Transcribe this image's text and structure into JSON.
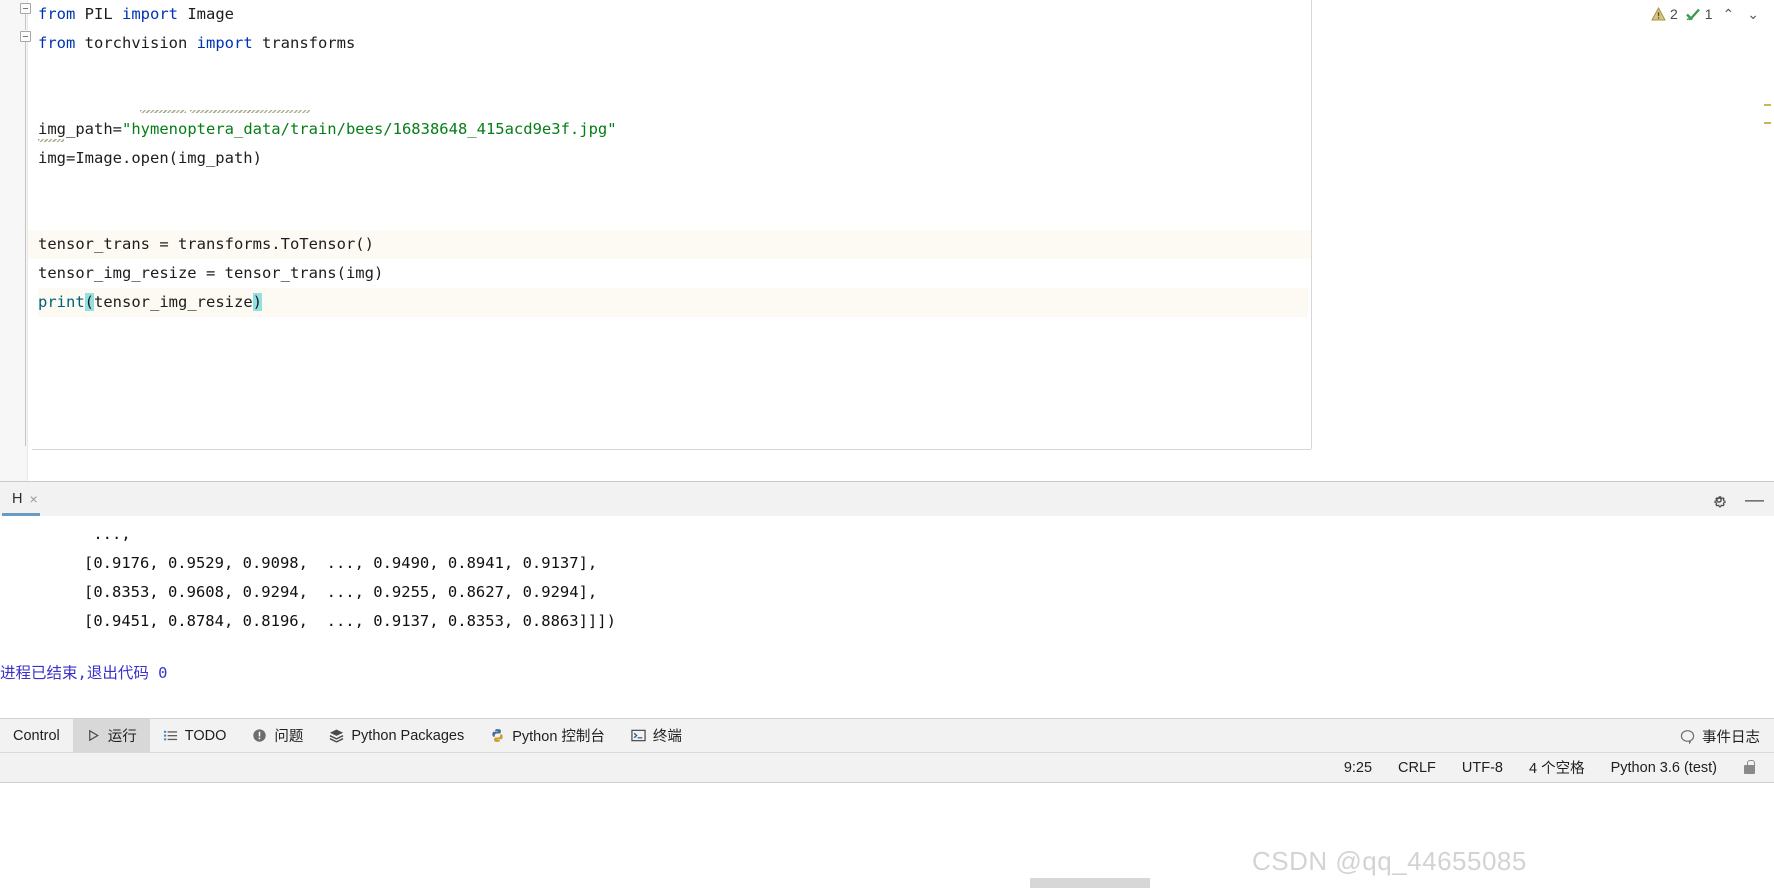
{
  "editor": {
    "lines": [
      {
        "id": "l1",
        "segments": [
          {
            "t": "from",
            "c": "kw"
          },
          {
            "t": " PIL ",
            "c": ""
          },
          {
            "t": "import",
            "c": "kw"
          },
          {
            "t": " Image",
            "c": ""
          }
        ]
      },
      {
        "id": "l2",
        "segments": [
          {
            "t": "from",
            "c": "kw"
          },
          {
            "t": " torchvision ",
            "c": ""
          },
          {
            "t": "import",
            "c": "kw"
          },
          {
            "t": " transforms",
            "c": ""
          }
        ]
      },
      {
        "id": "l3",
        "segments": []
      },
      {
        "id": "l4",
        "segments": []
      },
      {
        "id": "l5",
        "segments": [
          {
            "t": "img_path=",
            "c": ""
          },
          {
            "t": "\"hymenoptera_data/train/bees/16838648_415acd9e3f.jpg\"",
            "c": "str"
          }
        ]
      },
      {
        "id": "l6",
        "segments": [
          {
            "t": "img=Image.open(img_path)",
            "c": ""
          }
        ]
      },
      {
        "id": "l7",
        "segments": []
      },
      {
        "id": "l8",
        "segments": []
      },
      {
        "id": "l9",
        "segments": [
          {
            "t": "tensor_trans = transforms.ToTensor()",
            "c": ""
          }
        ]
      },
      {
        "id": "l10",
        "segments": [
          {
            "t": "tensor_img_resize = tensor_trans(img)",
            "c": ""
          }
        ]
      },
      {
        "id": "l11",
        "current": true,
        "segments": [
          {
            "t": "print",
            "c": "fn"
          },
          {
            "t": "(",
            "c": "paren-hl"
          },
          {
            "t": "tensor_img_resize",
            "c": ""
          },
          {
            "t": ")",
            "c": "paren-hl"
          }
        ]
      }
    ],
    "inspection": {
      "warning_icon": "warning-triangle-icon",
      "warning_count": "2",
      "ok_icon": "green-check-icon",
      "ok_count": "1",
      "prev_icon": "chevron-up-icon",
      "next_icon": "chevron-down-icon",
      "chevron_up": "⌃",
      "chevron_down": "⌄"
    }
  },
  "run_panel": {
    "tab": {
      "label": "H",
      "close_icon": "close-icon",
      "close_glyph": "×"
    },
    "settings_icon": "gear-icon",
    "minimize_icon": "minimize-icon",
    "minimize_glyph": "—",
    "console_lines": [
      "          ...,",
      "         [0.9176, 0.9529, 0.9098,  ..., 0.9490, 0.8941, 0.9137],",
      "         [0.8353, 0.9608, 0.9294,  ..., 0.9255, 0.8627, 0.9294],",
      "         [0.9451, 0.8784, 0.8196,  ..., 0.9137, 0.8353, 0.8863]]])"
    ],
    "exit_message": "进程已结束,退出代码 0"
  },
  "toolbar": {
    "items": [
      {
        "label": "Control",
        "icon": "",
        "active": false
      },
      {
        "label": "运行",
        "icon": "play-icon",
        "active": true
      },
      {
        "label": "TODO",
        "icon": "todo-list-icon",
        "active": false
      },
      {
        "label": "问题",
        "icon": "problems-icon",
        "active": false
      },
      {
        "label": "Python Packages",
        "icon": "packages-icon",
        "active": false
      },
      {
        "label": "Python 控制台",
        "icon": "python-icon",
        "active": false
      },
      {
        "label": "终端",
        "icon": "terminal-icon",
        "active": false
      }
    ],
    "event_log": {
      "label": "事件日志",
      "icon": "balloon-icon"
    }
  },
  "statusbar": {
    "caret_position": "9:25",
    "line_separator": "CRLF",
    "encoding": "UTF-8",
    "indent": "4 个空格",
    "interpreter": "Python 3.6 (test)",
    "lock_icon": "lock-icon"
  },
  "watermark": {
    "text": "CSDN @qq_44655085"
  },
  "colors": {
    "keyword": "#0033b3",
    "string": "#067d17",
    "function": "#00627a",
    "paren_highlight": "#93e0e3",
    "current_line": "#fcfaf2",
    "exit_text": "#3a31cc",
    "panel_bg": "#f2f2f2",
    "tab_underline": "#6a9bc3"
  }
}
